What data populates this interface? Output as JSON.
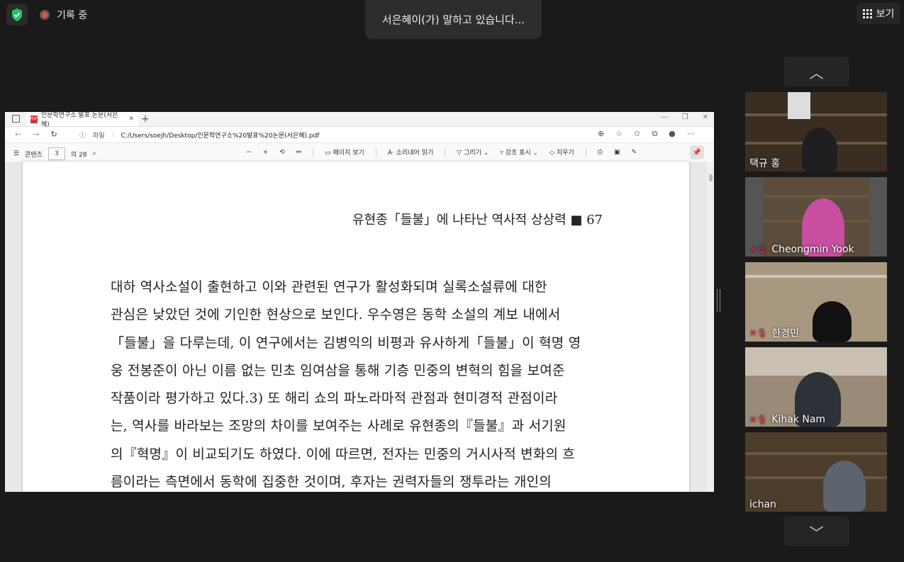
{
  "top": {
    "recording_label": "기록 중",
    "speaking_text": "서은혜이(가) 말하고 있습니다...",
    "view_label": "보기"
  },
  "browser": {
    "tab_title": "인문학연구소 발표 논문(서은혜)",
    "address_prefix": "파일",
    "url": "C:/Users/soejh/Desktop/인문학연구소%20발표%20논문(서은혜).pdf",
    "toolbar": {
      "contents_label": "콘텐츠",
      "page_current": "3",
      "page_total": "의 28",
      "page_view_label": "페이지 보기",
      "read_aloud_label": "소리내어 읽기",
      "draw_label": "그리기",
      "highlight_label": "강조 표시",
      "erase_label": "지우기"
    }
  },
  "document": {
    "running_head": "유현종「들불」에 나타난 역사적 상상력 ■ 67",
    "lines": [
      "대하 역사소설이 출현하고 이와 관련된 연구가 활성화되며 실록소설류에 대한",
      "관심은 낮았던 것에 기인한 현상으로 보인다. 우수영은 동학 소설의 계보 내에서",
      "「들불」을 다루는데, 이 연구에서는 김병익의 비평과 유사하게「들불」이 혁명 영",
      "웅 전봉준이 아닌 이름 없는 민초 임여삼을 통해 기층 민중의 변혁의 힘을 보여준",
      "작품이라 평가하고 있다.3) 또 해리 쇼의 파노라마적 관점과 현미경적 관점이라",
      "는, 역사를 바라보는 조망의 차이를 보여주는 사례로 유현종의『들불』과 서기원",
      "의『혁명』이 비교되기도 하였다. 이에 따르면, 전자는 민중의 거시사적 변화의 흐",
      "름이라는 측면에서 동학에 집중한 것이며, 후자는 권력자들의 쟁투라는 개인의"
    ]
  },
  "participants": [
    {
      "name": "택규 홍",
      "muted": false
    },
    {
      "name": "Cheongmin Yook",
      "muted": true
    },
    {
      "name": "한경민",
      "muted": true
    },
    {
      "name": "Kihak Nam",
      "muted": true
    },
    {
      "name": "ichan",
      "muted": false
    }
  ],
  "colors": {
    "shield": "#22c55e",
    "rec": "#e8524a",
    "mute": "#e22244"
  }
}
